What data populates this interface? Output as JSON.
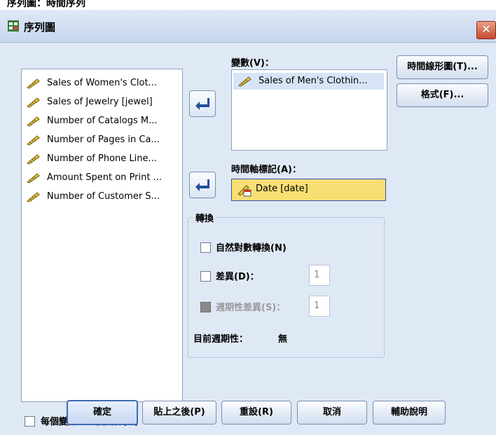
{
  "background_caption": "序列圖：時間序列",
  "window": {
    "title": "序列圖",
    "close_glyph": "✕"
  },
  "source_list": {
    "items": [
      {
        "label": "Sales of Women's Clot...",
        "icon": "scale-variable-icon"
      },
      {
        "label": "Sales of Jewelry [jewel]",
        "icon": "scale-variable-icon"
      },
      {
        "label": "Number of Catalogs M...",
        "icon": "scale-variable-icon"
      },
      {
        "label": "Number of Pages in Ca...",
        "icon": "scale-variable-icon"
      },
      {
        "label": "Number of Phone Line...",
        "icon": "scale-variable-icon"
      },
      {
        "label": "Amount Spent on Print ...",
        "icon": "scale-variable-icon"
      },
      {
        "label": "Number of Customer S...",
        "icon": "scale-variable-icon"
      }
    ]
  },
  "variables": {
    "label": "變數(V)：",
    "items": [
      {
        "label": "Sales of Men's Clothin...",
        "icon": "scale-variable-icon"
      }
    ]
  },
  "time_axis": {
    "label": "時間軸標記(A)：",
    "value": "Date [date]",
    "icon": "date-variable-icon"
  },
  "transform": {
    "label": "轉換",
    "natural_log": {
      "label": "自然對數轉換(N)",
      "checked": false
    },
    "difference": {
      "label": "差異(D)：",
      "checked": false,
      "value": "1"
    },
    "seasonal_difference": {
      "label": "週期性差異(S)：",
      "checked": false,
      "disabled": true,
      "value": "1"
    },
    "periodicity": {
      "label": "目前週期性：",
      "value": "無"
    }
  },
  "side_buttons": {
    "time_lines": "時間線形圖(T)...",
    "format": "格式(F)..."
  },
  "one_chart_per_variable": {
    "label": "每個變數畫一個圖表(O)",
    "checked": false
  },
  "bottom_buttons": {
    "ok": "確定",
    "paste": "貼上之後(P)",
    "reset": "重設(R)",
    "cancel": "取消",
    "help": "輔助說明"
  },
  "colors": {
    "client_bg": "#dfe8f5",
    "selected_fill": "#f7df73",
    "selected_border": "#3a4fa8",
    "title_bg": "#c7d7ee"
  }
}
